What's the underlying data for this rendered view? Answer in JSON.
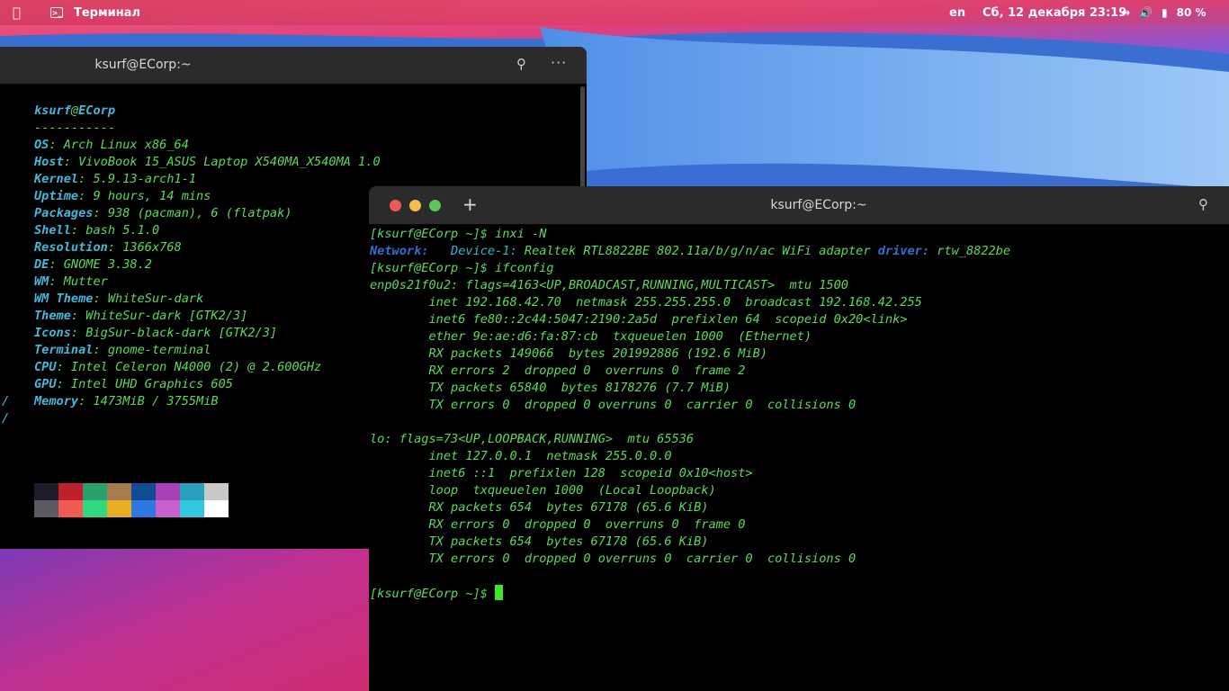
{
  "topbar": {
    "app_name": "Терминал",
    "lang": "en",
    "clock": "Сб, 12 декабря  23:19",
    "battery": "80 %"
  },
  "term1": {
    "title": "ksurf@ECorp:~",
    "neofetch": {
      "user": "ksurf",
      "at": "@",
      "host": "ECorp",
      "sep": "-----------",
      "fields": [
        {
          "key": "OS",
          "value": " Arch Linux x86_64"
        },
        {
          "key": "Host",
          "value": " VivoBook 15_ASUS Laptop X540MA_X540MA 1.0"
        },
        {
          "key": "Kernel",
          "value": " 5.9.13-arch1-1"
        },
        {
          "key": "Uptime",
          "value": " 9 hours, 14 mins"
        },
        {
          "key": "Packages",
          "value": " 938 (pacman), 6 (flatpak)"
        },
        {
          "key": "Shell",
          "value": " bash 5.1.0"
        },
        {
          "key": "Resolution",
          "value": " 1366x768"
        },
        {
          "key": "DE",
          "value": " GNOME 3.38.2"
        },
        {
          "key": "WM",
          "value": " Mutter"
        },
        {
          "key": "WM Theme",
          "value": " WhiteSur-dark"
        },
        {
          "key": "Theme",
          "value": " WhiteSur-dark [GTK2/3]"
        },
        {
          "key": "Icons",
          "value": " BigSur-black-dark [GTK2/3]"
        },
        {
          "key": "Terminal",
          "value": " gnome-terminal"
        },
        {
          "key": "CPU",
          "value": " Intel Celeron N4000 (2) @ 2.600GHz"
        },
        {
          "key": "GPU",
          "value": " Intel UHD Graphics 605"
        },
        {
          "key": "Memory",
          "value": " 1473MiB / 3755MiB"
        }
      ],
      "colon": ":",
      "slash": "/",
      "palette_top": [
        "#1c1c2a",
        "#c0202e",
        "#2aa06a",
        "#a87a50",
        "#124a94",
        "#a840b8",
        "#28a0c0",
        "#c8c8c8"
      ],
      "palette_bottom": [
        "#5a5a64",
        "#f05a50",
        "#30d880",
        "#e8b020",
        "#2a78e0",
        "#c860d0",
        "#30c8e0",
        "#ffffff"
      ]
    }
  },
  "term2": {
    "title": "ksurf@ECorp:~",
    "prompt": "[ksurf@ECorp ~]$",
    "cmd1": " inxi -N",
    "net_key": "Network:",
    "dev_key": "   Device-1:",
    "dev_val": " Realtek RTL8822BE 802.11a/b/g/n/ac WiFi adapter ",
    "drv_key": "driver:",
    "drv_val": " rtw_8822be",
    "cmd2": " ifconfig",
    "lines": [
      "enp0s21f0u2: flags=4163<UP,BROADCAST,RUNNING,MULTICAST>  mtu 1500",
      "        inet 192.168.42.70  netmask 255.255.255.0  broadcast 192.168.42.255",
      "        inet6 fe80::2c44:5047:2190:2a5d  prefixlen 64  scopeid 0x20<link>",
      "        ether 9e:ae:d6:fa:87:cb  txqueuelen 1000  (Ethernet)",
      "        RX packets 149066  bytes 201992886 (192.6 MiB)",
      "        RX errors 2  dropped 0  overruns 0  frame 2",
      "        TX packets 65840  bytes 8178276 (7.7 MiB)",
      "        TX errors 0  dropped 0 overruns 0  carrier 0  collisions 0",
      "",
      "lo: flags=73<UP,LOOPBACK,RUNNING>  mtu 65536",
      "        inet 127.0.0.1  netmask 255.0.0.0",
      "        inet6 ::1  prefixlen 128  scopeid 0x10<host>",
      "        loop  txqueuelen 1000  (Local Loopback)",
      "        RX packets 654  bytes 67178 (65.6 KiB)",
      "        RX errors 0  dropped 0  overruns 0  frame 0",
      "        TX packets 654  bytes 67178 (65.6 KiB)",
      "        TX errors 0  dropped 0 overruns 0  carrier 0  collisions 0",
      ""
    ],
    "final_prompt": "[ksurf@ECorp ~]$ "
  }
}
